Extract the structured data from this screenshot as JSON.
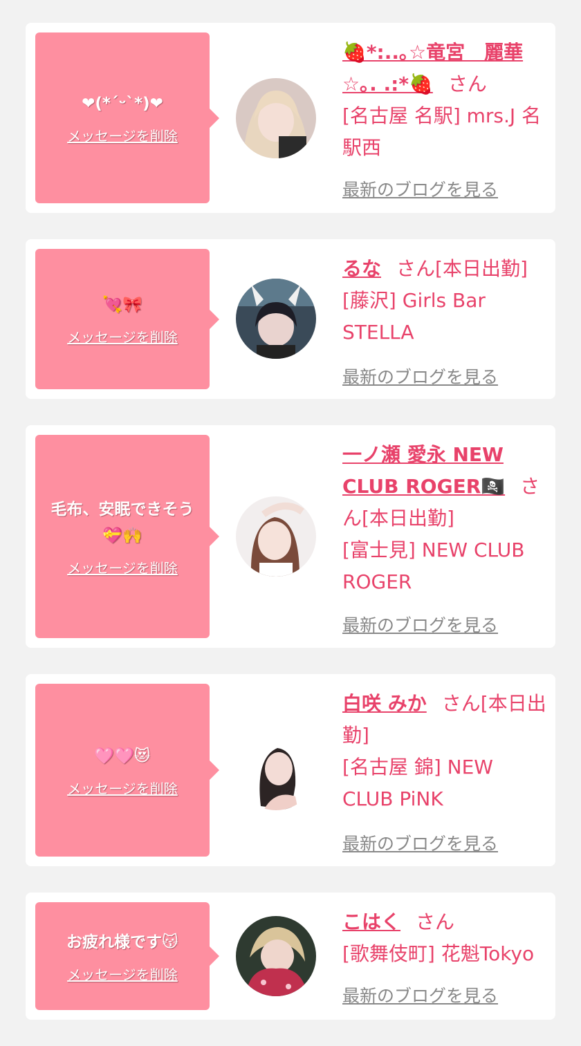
{
  "delete_label": "メッセージを削除",
  "blog_label": "最新のブログを見る",
  "honorific": "さん",
  "colors": {
    "background": "#f2f2f2",
    "bubble": "#fe8fa0",
    "accent": "#e8426a",
    "link_gray": "#888888"
  },
  "cards": [
    {
      "message": "❤(*´ᵕ`*)❤",
      "name": "🍓*:..｡☆竜宮　麗華☆｡. .:*🍓",
      "status": "",
      "location": "[名古屋 名駅] mrs.J 名駅西"
    },
    {
      "message": "💘🎀",
      "name": "るな",
      "status": "[本日出勤]",
      "location": "[藤沢] Girls Bar STELLA"
    },
    {
      "message": "毛布、安眠できそう💝🙌",
      "name": "一ノ瀬 愛永 NEW CLUB ROGER🏴‍☠️",
      "status": "[本日出勤]",
      "location": "[富士見] NEW CLUB ROGER"
    },
    {
      "message": "🩷🩷😻",
      "name": "白咲 みか",
      "status": "[本日出勤]",
      "location": "[名古屋 錦] NEW CLUB PiNK"
    },
    {
      "message": "お疲れ様です😽",
      "name": "こはく",
      "status": "",
      "location": "[歌舞伎町] 花魁Tokyo"
    }
  ]
}
